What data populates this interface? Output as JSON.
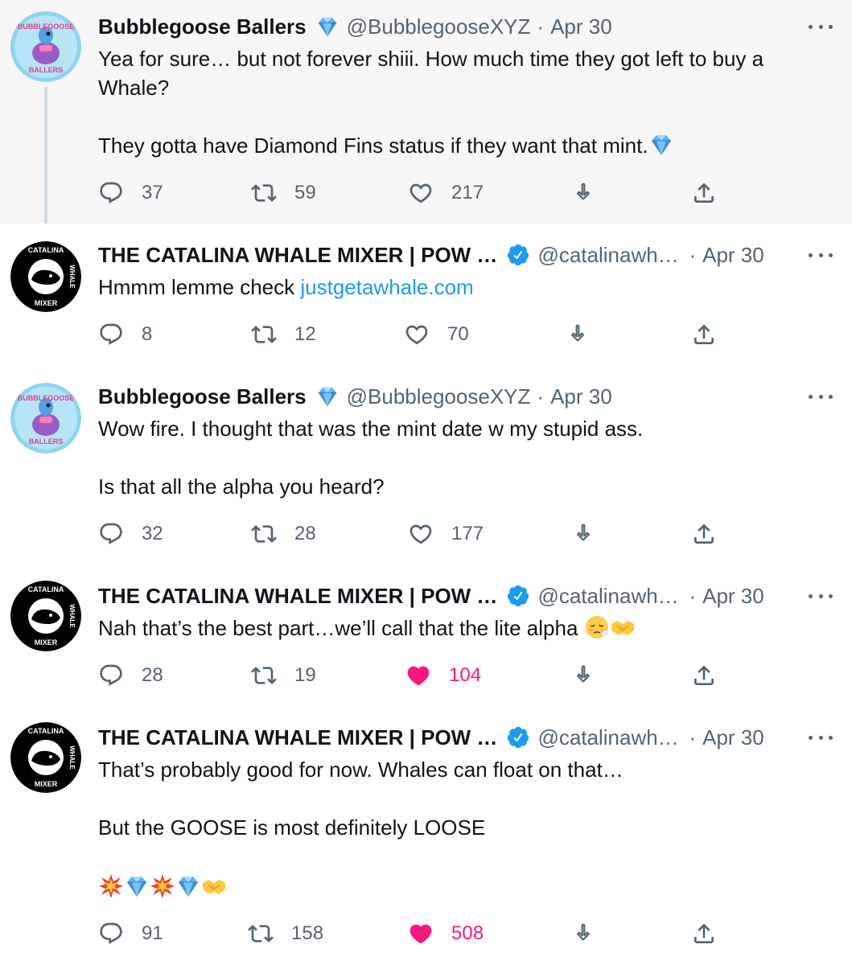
{
  "tweets": [
    {
      "author_name": "Bubblegoose Ballers",
      "handle": "@BubblegooseXYZ",
      "date": "Apr 30",
      "badge": "diamond-emoji",
      "lines": [
        "Yea for sure… but not forever shiii. How much time they got left to buy a",
        "Whale?",
        "",
        "They gotta have Diamond Fins status if they want that mint."
      ],
      "replies": "37",
      "retweets": "59",
      "likes": "217",
      "liked": false
    },
    {
      "author_name": "THE CATALINA WHALE MIXER | POW …",
      "handle": "@catalinawh…",
      "date": "Apr 30",
      "badge": "verified-badge",
      "text_prefix": "Hmmm lemme check ",
      "link": "justgetawhale.com",
      "replies": "8",
      "retweets": "12",
      "likes": "70",
      "liked": false
    },
    {
      "author_name": "Bubblegoose Ballers",
      "handle": "@BubblegooseXYZ",
      "date": "Apr 30",
      "badge": "diamond-emoji",
      "lines": [
        "Wow fire. I thought that was the mint date w my stupid ass.",
        "",
        "Is that all the alpha you heard?"
      ],
      "replies": "32",
      "retweets": "28",
      "likes": "177",
      "liked": false
    },
    {
      "author_name": "THE CATALINA WHALE MIXER | POW …",
      "handle": "@catalinawh…",
      "date": "Apr 30",
      "badge": "verified-badge",
      "lines": [
        "Nah that’s the best part…we’ll call that the lite alpha"
      ],
      "replies": "28",
      "retweets": "19",
      "likes": "104",
      "liked": true
    },
    {
      "author_name": "THE CATALINA WHALE MIXER | POW …",
      "handle": "@catalinawh…",
      "date": "Apr 30",
      "badge": "verified-badge",
      "lines": [
        "That’s probably good for now. Whales can float on that…",
        "",
        "But the GOOSE is most definitely LOOSE"
      ],
      "replies": "91",
      "retweets": "158",
      "likes": "508",
      "liked": true
    }
  ],
  "avatars": {
    "bubblegoose_top": "BUBBLEGOOSE",
    "bubblegoose_bottom": "BALLERS",
    "catalina_top": "CATALINA",
    "catalina_right": "WHALE",
    "catalina_bottom": "MIXER"
  },
  "colors": {
    "accent": "#1d9bf0",
    "like": "#f91880",
    "muted": "#536471",
    "highlight_bg": "#f7f7f7"
  }
}
